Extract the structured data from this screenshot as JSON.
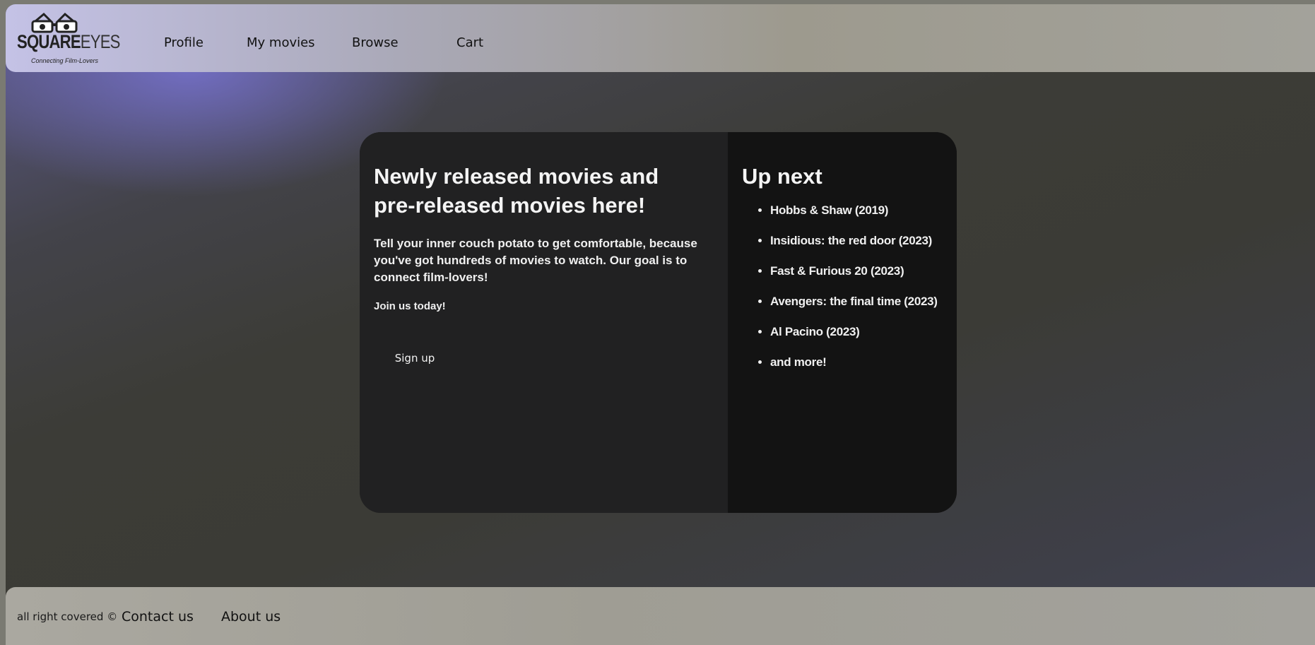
{
  "brand": {
    "name_bold": "SQUARE",
    "name_light": "EYES",
    "tagline": "Connecting Film-Lovers",
    "icon": "3d-glasses-icon"
  },
  "nav": {
    "items": [
      {
        "label": "Profile"
      },
      {
        "label": "My movies"
      },
      {
        "label": "Browse"
      },
      {
        "label": "Cart"
      }
    ]
  },
  "hero": {
    "title": "Newly released movies and pre-released movies here!",
    "description": "Tell your inner couch potato to get comfortable, because you've got hundreds of movies to watch. Our goal is to connect film-lovers!",
    "join": "Join us today!",
    "signup_label": "Sign up"
  },
  "upnext": {
    "title": "Up next",
    "items": [
      "Hobbs & Shaw (2019)",
      "Insidious: the red door (2023)",
      "Fast & Furious 20 (2023)",
      "Avengers: the final time (2023)",
      "Al Pacino (2023)",
      "and more!"
    ]
  },
  "footer": {
    "copyright": "all right covered ©",
    "links": [
      {
        "label": "Contact us"
      },
      {
        "label": "About us"
      }
    ]
  },
  "colors": {
    "card_left": "#212122",
    "card_right": "#131313",
    "header_start": "#c4c2e6",
    "header_end": "#a3a29b",
    "text_light": "#f4f4f4"
  }
}
